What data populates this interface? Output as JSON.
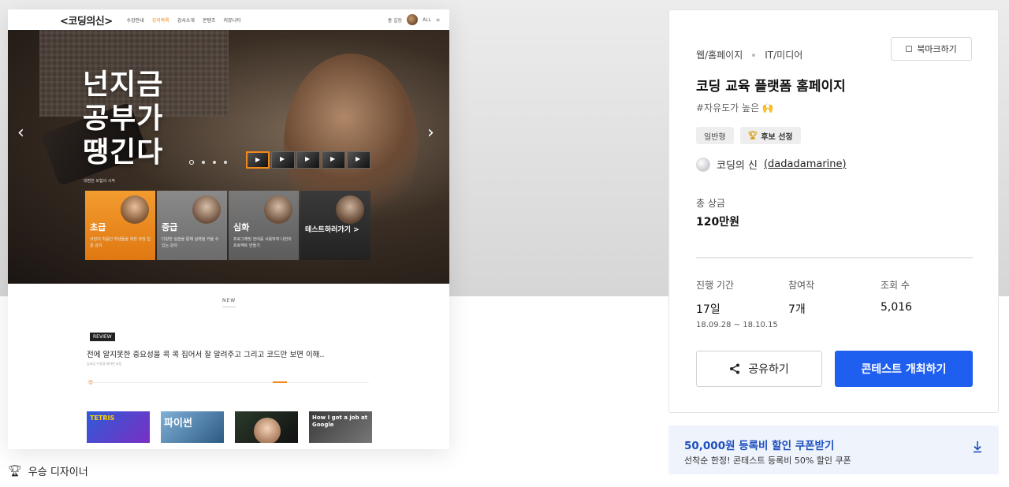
{
  "preview": {
    "site_nav": {
      "logo": "<코딩의신>",
      "menu": [
        "수강안내",
        "강의목록",
        "강사소개",
        "콘텐츠",
        "커뮤니티"
      ],
      "user": "홍 길동",
      "extras": [
        "ALL"
      ]
    },
    "hero": {
      "title_lines": [
        "넌지금",
        "공부가",
        "땡긴다"
      ],
      "caption": "대범한 모험의 시작",
      "cards": [
        {
          "title": "초급",
          "desc": "코딩이 처음인 학생들을 위한 코딩 입문 강의"
        },
        {
          "title": "중급",
          "desc": "다양한 실습을 통해 실력을 키울 수 있는 강의"
        },
        {
          "title": "심화",
          "desc": "프로그래밍 언어를 사용하여 나만의 프로젝트 만들기"
        },
        {
          "title": "테스트하러가기 >",
          "desc": ""
        }
      ]
    },
    "body": {
      "new_label": "NEW",
      "review_tag": "REVIEW",
      "review_text": "전에 알지못한 중요성을 콕 콕 집어서 잘 알려주고 그리고 코드만 보면 이해..",
      "review_sub": "김코딩 수강생 파이썬 코딩",
      "thumbs": [
        "TETRIS",
        "파이썬",
        "",
        "How I got a job at Google"
      ]
    }
  },
  "winner_label": "우승 디자이너",
  "contest": {
    "category": "웹/홈페이지",
    "industry": "IT/미디어",
    "bookmark_label": "북마크하기",
    "title": "코딩 교육 플랫폼 홈페이지",
    "hashtag": "#자유도가 높은 🙌",
    "badges": [
      "일반형",
      "후보 선정"
    ],
    "host_name": "코딩의 신",
    "host_id": "(dadadamarine)",
    "prize_label": "총 상금",
    "prize_value": "120만원",
    "stats": [
      {
        "label": "진행 기간",
        "value": "17일",
        "sub": "18.09.28 ~ 18.10.15"
      },
      {
        "label": "참여작",
        "value": "7개",
        "sub": ""
      },
      {
        "label": "조회 수",
        "value": "5,016",
        "sub": ""
      }
    ],
    "share_label": "공유하기",
    "open_label": "콘테스트 개최하기"
  },
  "coupon": {
    "title": "50,000원 등록비 할인 쿠폰받기",
    "subtitle": "선착순 한정! 콘테스트 등록비 50% 할인 쿠폰"
  },
  "colors": {
    "accent_blue": "#1f5ff0",
    "brand_orange": "#f08a1c",
    "coupon_bg": "#eef3fc",
    "coupon_text": "#1e4fbf"
  }
}
